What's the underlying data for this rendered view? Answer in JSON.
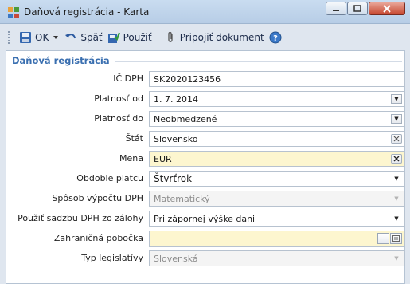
{
  "window": {
    "title": "Daňová registrácia - Karta",
    "minimize_icon": "minimize-icon",
    "maximize_icon": "maximize-icon",
    "close_icon": "close-icon"
  },
  "toolbar": {
    "ok_label": "OK",
    "back_label": "Späť",
    "apply_label": "Použiť",
    "attach_label": "Pripojiť dokument",
    "icons": [
      "save-icon",
      "chevron-down-icon",
      "undo-icon",
      "apply-icon",
      "paperclip-icon",
      "help-icon"
    ]
  },
  "section": {
    "title": "Daňová registrácia"
  },
  "fields": [
    {
      "label": "IČ DPH",
      "value": "SK2020123456"
    },
    {
      "label": "Platnosť od",
      "value": "1. 7. 2014"
    },
    {
      "label": "Platnosť do",
      "value": "Neobmedzené"
    },
    {
      "label": "Štát",
      "value": "Slovensko"
    },
    {
      "label": "Mena",
      "value": "EUR"
    },
    {
      "label": "Obdobie platcu",
      "value": "Štvrťrok"
    },
    {
      "label": "Spôsob výpočtu DPH",
      "value": "Matematický"
    },
    {
      "label": "Použiť sadzbu DPH zo zálohy",
      "value": "Pri zápornej výške dani"
    },
    {
      "label": "Zahraničná pobočka",
      "value": ""
    },
    {
      "label": "Typ legislatívy",
      "value": "Slovenská"
    }
  ],
  "colors": {
    "section_title": "#3a6fb0",
    "required_bg": "#fdf6cf",
    "close_button": "#c7472f"
  }
}
